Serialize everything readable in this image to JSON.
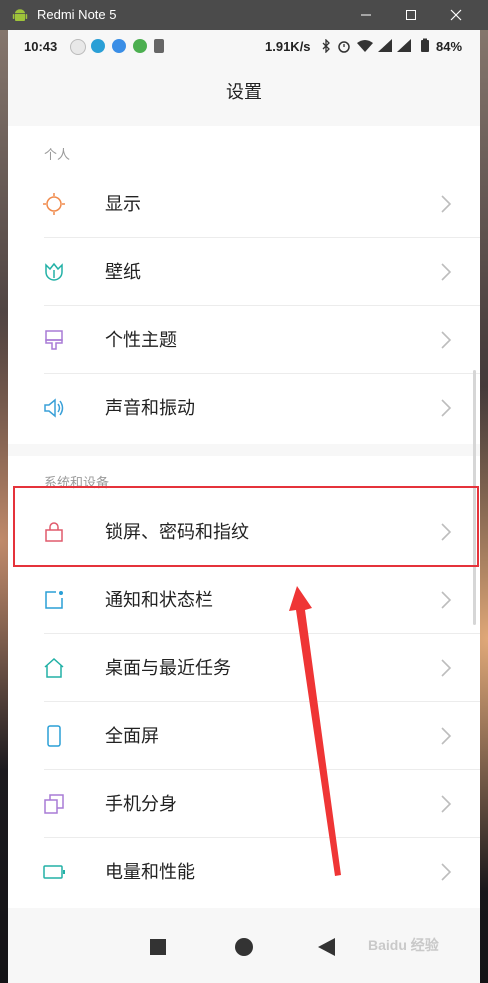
{
  "window": {
    "title": "Redmi Note 5"
  },
  "statusbar": {
    "time": "10:43",
    "speed": "1.91K/s",
    "battery": "84%"
  },
  "header": {
    "title": "设置"
  },
  "sections": [
    {
      "label": "个人",
      "items": [
        {
          "label": "显示",
          "icon": "sun-icon",
          "color": "#f08a4b"
        },
        {
          "label": "壁纸",
          "icon": "tulip-icon",
          "color": "#22b1a6"
        },
        {
          "label": "个性主题",
          "icon": "paintbrush-icon",
          "color": "#a97bd6"
        },
        {
          "label": "声音和振动",
          "icon": "speaker-icon",
          "color": "#3aa0d8"
        }
      ]
    },
    {
      "label": "系统和设备",
      "items": [
        {
          "label": "锁屏、密码和指纹",
          "icon": "lock-icon",
          "color": "#e05a6c"
        },
        {
          "label": "通知和状态栏",
          "icon": "notification-icon",
          "color": "#2a9fd6"
        },
        {
          "label": "桌面与最近任务",
          "icon": "home-icon",
          "color": "#22b1a6"
        },
        {
          "label": "全面屏",
          "icon": "phone-icon",
          "color": "#2a9fd6"
        },
        {
          "label": "手机分身",
          "icon": "clone-icon",
          "color": "#a97bd6"
        },
        {
          "label": "电量和性能",
          "icon": "battery-icon",
          "color": "#22b1a6"
        }
      ]
    }
  ],
  "watermark": "Baidu 经验"
}
